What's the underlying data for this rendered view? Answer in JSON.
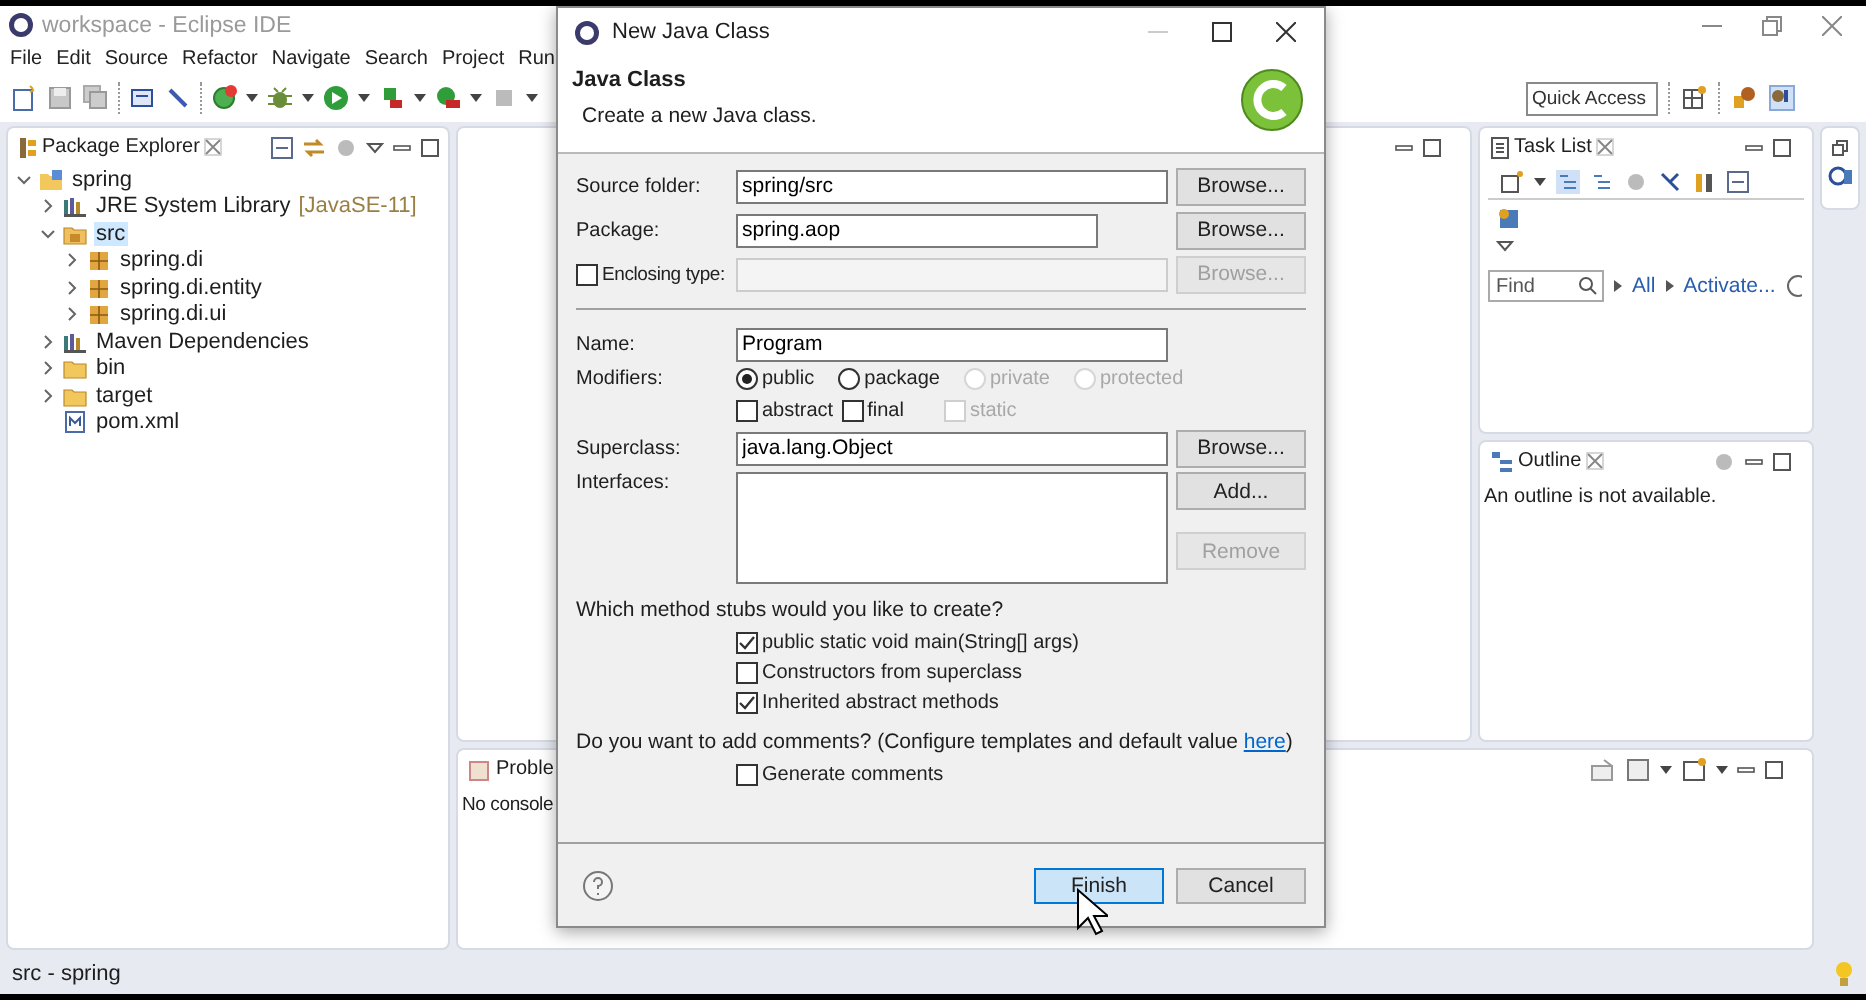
{
  "window": {
    "title": "workspace - Eclipse IDE"
  },
  "menu": [
    "File",
    "Edit",
    "Source",
    "Refactor",
    "Navigate",
    "Search",
    "Project",
    "Run"
  ],
  "quick_access": {
    "placeholder": "Quick Access"
  },
  "package_explorer": {
    "title": "Package Explorer",
    "tree": [
      {
        "label": "spring",
        "kind": "project",
        "expanded": true,
        "selected": false,
        "children": [
          {
            "label": "JRE System Library",
            "suffix": "[JavaSE-11]",
            "kind": "library",
            "expanded": false,
            "selected": false
          },
          {
            "label": "src",
            "kind": "source",
            "expanded": true,
            "selected": true,
            "children": [
              {
                "label": "spring.di",
                "kind": "package",
                "expanded": false,
                "selected": false
              },
              {
                "label": "spring.di.entity",
                "kind": "package",
                "expanded": false,
                "selected": false
              },
              {
                "label": "spring.di.ui",
                "kind": "package",
                "expanded": false,
                "selected": false
              }
            ]
          },
          {
            "label": "Maven Dependencies",
            "kind": "library",
            "expanded": false,
            "selected": false
          },
          {
            "label": "bin",
            "kind": "folder",
            "expanded": false,
            "selected": false
          },
          {
            "label": "target",
            "kind": "folder",
            "expanded": false,
            "selected": false
          },
          {
            "label": "pom.xml",
            "kind": "file",
            "selected": false
          }
        ]
      }
    ]
  },
  "problems": {
    "tab": "Proble",
    "message": "No console"
  },
  "task_list": {
    "title": "Task List",
    "find": {
      "placeholder": "Find"
    },
    "links": [
      "All",
      "Activate..."
    ]
  },
  "outline": {
    "title": "Outline",
    "message": "An outline is not available."
  },
  "status_bar": {
    "text": "src - spring"
  },
  "dialog": {
    "title": "New Java Class",
    "heading": "Java Class",
    "description": "Create a new Java class.",
    "source_folder": {
      "label": "Source folder:",
      "value": "spring/src",
      "button": "Browse..."
    },
    "package": {
      "label": "Package:",
      "value": "spring.aop",
      "button": "Browse..."
    },
    "enclosing_type": {
      "label": "Enclosing type:",
      "checked": false,
      "button": "Browse...",
      "disabled": true
    },
    "name": {
      "label": "Name:",
      "value": "Program"
    },
    "modifiers": {
      "label": "Modifiers:",
      "access": [
        {
          "label": "public",
          "selected": true,
          "disabled": false
        },
        {
          "label": "package",
          "selected": false,
          "disabled": false
        },
        {
          "label": "private",
          "selected": false,
          "disabled": true
        },
        {
          "label": "protected",
          "selected": false,
          "disabled": true
        }
      ],
      "flags": [
        {
          "label": "abstract",
          "checked": false,
          "disabled": false
        },
        {
          "label": "final",
          "checked": false,
          "disabled": false
        },
        {
          "label": "static",
          "checked": false,
          "disabled": true
        }
      ]
    },
    "superclass": {
      "label": "Superclass:",
      "value": "java.lang.Object",
      "button": "Browse..."
    },
    "interfaces": {
      "label": "Interfaces:",
      "buttons": [
        {
          "label": "Add...",
          "disabled": false
        },
        {
          "label": "Remove",
          "disabled": true
        }
      ]
    },
    "stubs": {
      "question": "Which method stubs would you like to create?",
      "options": [
        {
          "label": "public static void main(String[] args)",
          "checked": true
        },
        {
          "label": "Constructors from superclass",
          "checked": false
        },
        {
          "label": "Inherited abstract methods",
          "checked": true
        }
      ]
    },
    "comments": {
      "question_start": "Do you want to add comments? (Configure templates and default value ",
      "link": "here",
      "question_end": ")",
      "option": {
        "label": "Generate comments",
        "checked": false
      }
    },
    "buttons": [
      {
        "label": "Finish",
        "default": true
      },
      {
        "label": "Cancel",
        "default": false
      }
    ]
  }
}
